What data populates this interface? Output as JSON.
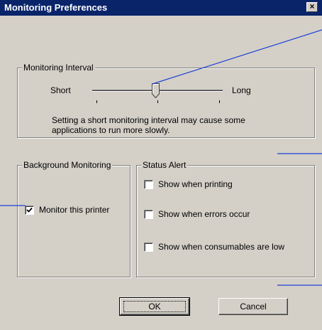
{
  "window": {
    "title": "Monitoring Preferences",
    "close_glyph": "×"
  },
  "monitoring_interval": {
    "label": "Monitoring Interval",
    "short_label": "Short",
    "long_label": "Long",
    "slider_value_fraction": 0.48,
    "note": "Setting a short monitoring interval may cause some applications to run more slowly."
  },
  "background_monitoring": {
    "label": "Background Monitoring",
    "monitor_printer": {
      "label": "Monitor this printer",
      "checked": true
    }
  },
  "status_alert": {
    "label": "Status Alert",
    "options": [
      {
        "label": "Show when printing",
        "checked": false
      },
      {
        "label": "Show when errors occur",
        "checked": false
      },
      {
        "label": "Show when consumables are low",
        "checked": false
      }
    ]
  },
  "buttons": {
    "ok_label": "OK",
    "cancel_label": "Cancel"
  },
  "colors": {
    "titlebar": "#0a246a",
    "dialog_face": "#d4d0c8",
    "callout_line": "#1f3fd6"
  },
  "icons": {
    "close": "close-icon",
    "check": "checkmark-icon",
    "slider_thumb": "slider-thumb-icon"
  }
}
